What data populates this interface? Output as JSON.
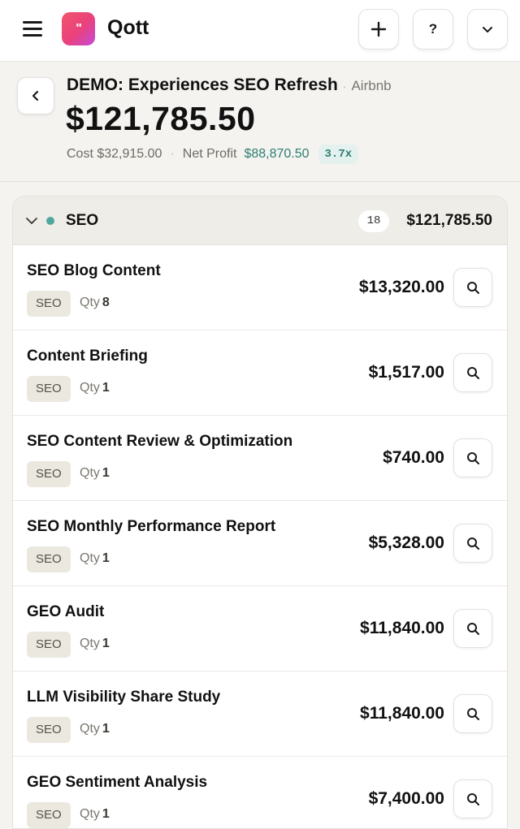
{
  "app": {
    "name": "Qott",
    "logo_glyph": "\""
  },
  "topbar": {
    "add_icon": "plus-icon",
    "help_label": "?",
    "menu_icon": "chevron-down-icon"
  },
  "project": {
    "title": "DEMO: Experiences SEO Refresh",
    "separator": "·",
    "client": "Airbnb",
    "total": "$121,785.50",
    "cost_label": "Cost",
    "cost": "$32,915.00",
    "net_profit_label": "Net Profit",
    "net_profit": "$88,870.50",
    "ratio": "3.7x"
  },
  "colors": {
    "accent_teal": "#2f7f74",
    "status_dot": "#4fa8a0",
    "logo_start": "#f2566a",
    "logo_end": "#c44ad9"
  },
  "group": {
    "name": "SEO",
    "count": "18",
    "total": "$121,785.50",
    "items": [
      {
        "title": "SEO Blog Content",
        "tag": "SEO",
        "qty_label": "Qty",
        "qty": "8",
        "price": "$13,320.00"
      },
      {
        "title": "Content Briefing",
        "tag": "SEO",
        "qty_label": "Qty",
        "qty": "1",
        "price": "$1,517.00"
      },
      {
        "title": "SEO Content Review & Optimization",
        "tag": "SEO",
        "qty_label": "Qty",
        "qty": "1",
        "price": "$740.00"
      },
      {
        "title": "SEO Monthly Performance Report",
        "tag": "SEO",
        "qty_label": "Qty",
        "qty": "1",
        "price": "$5,328.00"
      },
      {
        "title": "GEO Audit",
        "tag": "SEO",
        "qty_label": "Qty",
        "qty": "1",
        "price": "$11,840.00"
      },
      {
        "title": "LLM Visibility Share Study",
        "tag": "SEO",
        "qty_label": "Qty",
        "qty": "1",
        "price": "$11,840.00"
      },
      {
        "title": "GEO Sentiment Analysis",
        "tag": "SEO",
        "qty_label": "Qty",
        "qty": "1",
        "price": "$7,400.00"
      }
    ]
  }
}
